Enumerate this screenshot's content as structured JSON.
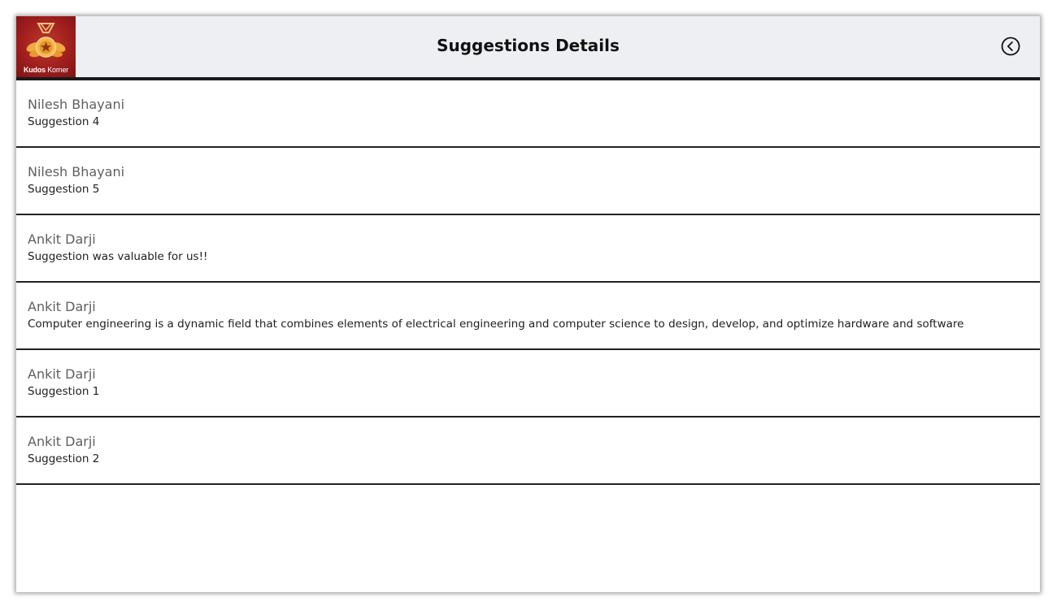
{
  "header": {
    "title": "Suggestions Details",
    "logo": {
      "name_bold": "Kudos",
      "name_rest": " Korner",
      "icon": "medal-icon"
    },
    "back_icon": "back-circle-icon"
  },
  "colors": {
    "header_bg": "#edeff2",
    "logo_bg": "#a01e1e",
    "divider": "#222222",
    "name_text": "#5f5f5f",
    "body_text": "#1e1e1e"
  },
  "suggestions": [
    {
      "name": "Nilesh Bhayani",
      "text": "Suggestion 4"
    },
    {
      "name": "Nilesh Bhayani",
      "text": "Suggestion 5"
    },
    {
      "name": "Ankit Darji",
      "text": "Suggestion was valuable for us!!"
    },
    {
      "name": "Ankit Darji",
      "text": "Computer engineering is a dynamic field that combines elements of electrical engineering and computer science to design, develop, and optimize hardware and software"
    },
    {
      "name": "Ankit Darji",
      "text": "Suggestion 1"
    },
    {
      "name": "Ankit Darji",
      "text": "Suggestion 2"
    }
  ]
}
